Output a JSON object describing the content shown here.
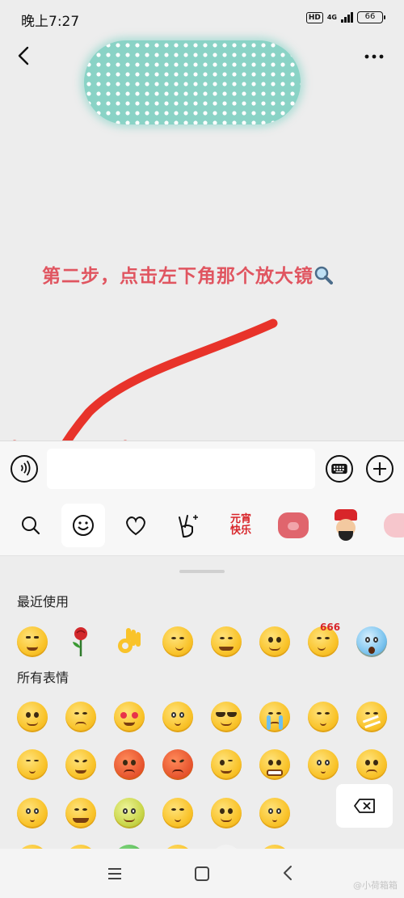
{
  "status_bar": {
    "time": "晚上7:27",
    "hd": "HD",
    "network": "4G",
    "battery": "66"
  },
  "annotation": {
    "text": "第二步，点击左下角那个放大镜",
    "color": "#e05560",
    "arrow_color": "#e8332a"
  },
  "input_bar": {
    "voice_icon": "voice-icon",
    "keyboard_icon": "keyboard-icon",
    "plus_icon": "plus-icon"
  },
  "emoji_tabs": [
    {
      "name": "search-icon",
      "active": false
    },
    {
      "name": "smiley-icon",
      "active": true
    },
    {
      "name": "heart-icon",
      "active": false
    },
    {
      "name": "victory-hand-icon",
      "active": false
    },
    {
      "name": "sticker-yuanxiao",
      "active": false,
      "text_line1": "元宵",
      "text_line2": "快乐"
    },
    {
      "name": "sticker-pig",
      "active": false
    },
    {
      "name": "sticker-god-of-wealth",
      "active": false
    },
    {
      "name": "sticker-pink-pig",
      "active": false
    }
  ],
  "panel": {
    "recent_title": "最近使用",
    "all_title": "所有表情",
    "badge_666": "666",
    "recent": [
      "facepalm-laugh",
      "rose",
      "ok-hand",
      "smirk",
      "tears-of-joy",
      "smile",
      "cool-666",
      "scream"
    ],
    "all_rows": [
      [
        "smile",
        "embarrassed",
        "heart-eyes",
        "shocked",
        "sunglasses",
        "crying",
        "shy",
        "shut-mouth"
      ],
      [
        "sleepy",
        "annoyed",
        "angry-red",
        "furious",
        "wink",
        "grin",
        "doubt",
        "sad"
      ],
      [
        "blush",
        "laughing-cry",
        "sick",
        "hee-hee",
        "smiling",
        "wow"
      ]
    ],
    "delete_icon": "backspace-icon"
  },
  "system_nav": {
    "watermark": "@小荷箱箱"
  }
}
